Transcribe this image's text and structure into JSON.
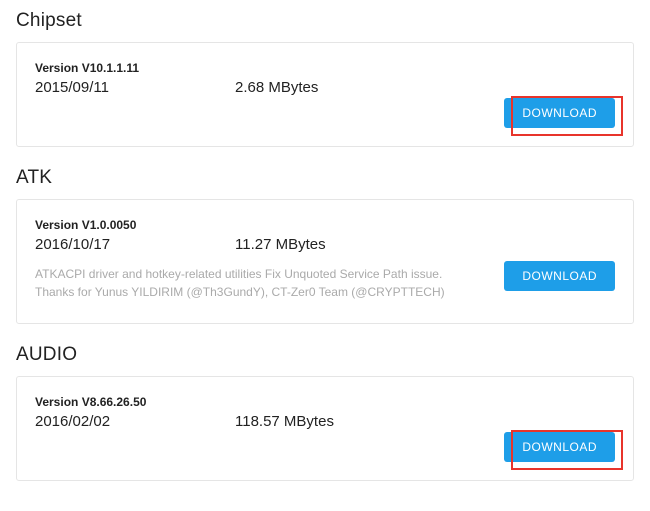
{
  "sections": [
    {
      "title": "Chipset",
      "version_label": "Version V10.1.1.11",
      "date": "2015/09/11",
      "size": "2.68 MBytes",
      "desc": "",
      "download_label": "DOWNLOAD",
      "highlighted": true
    },
    {
      "title": "ATK",
      "version_label": "Version V1.0.0050",
      "date": "2016/10/17",
      "size": "11.27 MBytes",
      "desc": "ATKACPI driver and hotkey-related utilities Fix Unquoted Service Path issue. Thanks for Yunus YILDIRIM (@Th3GundY), CT-Zer0 Team (@CRYPTTECH)",
      "download_label": "DOWNLOAD",
      "highlighted": false
    },
    {
      "title": "AUDIO",
      "version_label": "Version V8.66.26.50",
      "date": "2016/02/02",
      "size": "118.57 MBytes",
      "desc": "",
      "download_label": "DOWNLOAD",
      "highlighted": true
    }
  ]
}
